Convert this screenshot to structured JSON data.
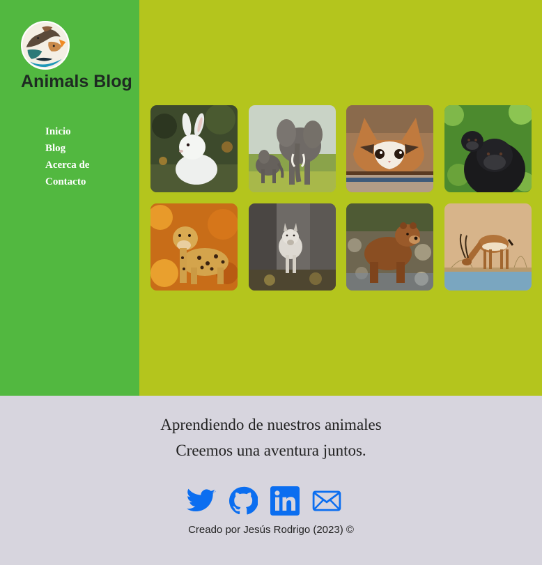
{
  "sidebar": {
    "brand": "Animals Blog",
    "nav": [
      {
        "label": "Inicio"
      },
      {
        "label": "Blog"
      },
      {
        "label": "Acerca de"
      },
      {
        "label": "Contacto"
      }
    ]
  },
  "gallery": [
    {
      "name": "rabbit-photo"
    },
    {
      "name": "elephant-photo"
    },
    {
      "name": "cat-photo"
    },
    {
      "name": "gorilla-photo"
    },
    {
      "name": "jaguar-photo"
    },
    {
      "name": "wolf-photo"
    },
    {
      "name": "bear-photo"
    },
    {
      "name": "gazelle-photo"
    }
  ],
  "footer": {
    "line1": "Aprendiendo de nuestros animales",
    "line2": "Creemos una aventura juntos.",
    "credit": "Creado por Jesús Rodrigo (2023) ©",
    "social": [
      {
        "icon": "twitter-icon"
      },
      {
        "icon": "github-icon"
      },
      {
        "icon": "linkedin-icon"
      },
      {
        "icon": "mail-icon"
      }
    ]
  },
  "colors": {
    "sidebar": "#52b840",
    "main": "#b4c51d",
    "footer": "#d7d5de",
    "icon": "#0b6ef0"
  }
}
